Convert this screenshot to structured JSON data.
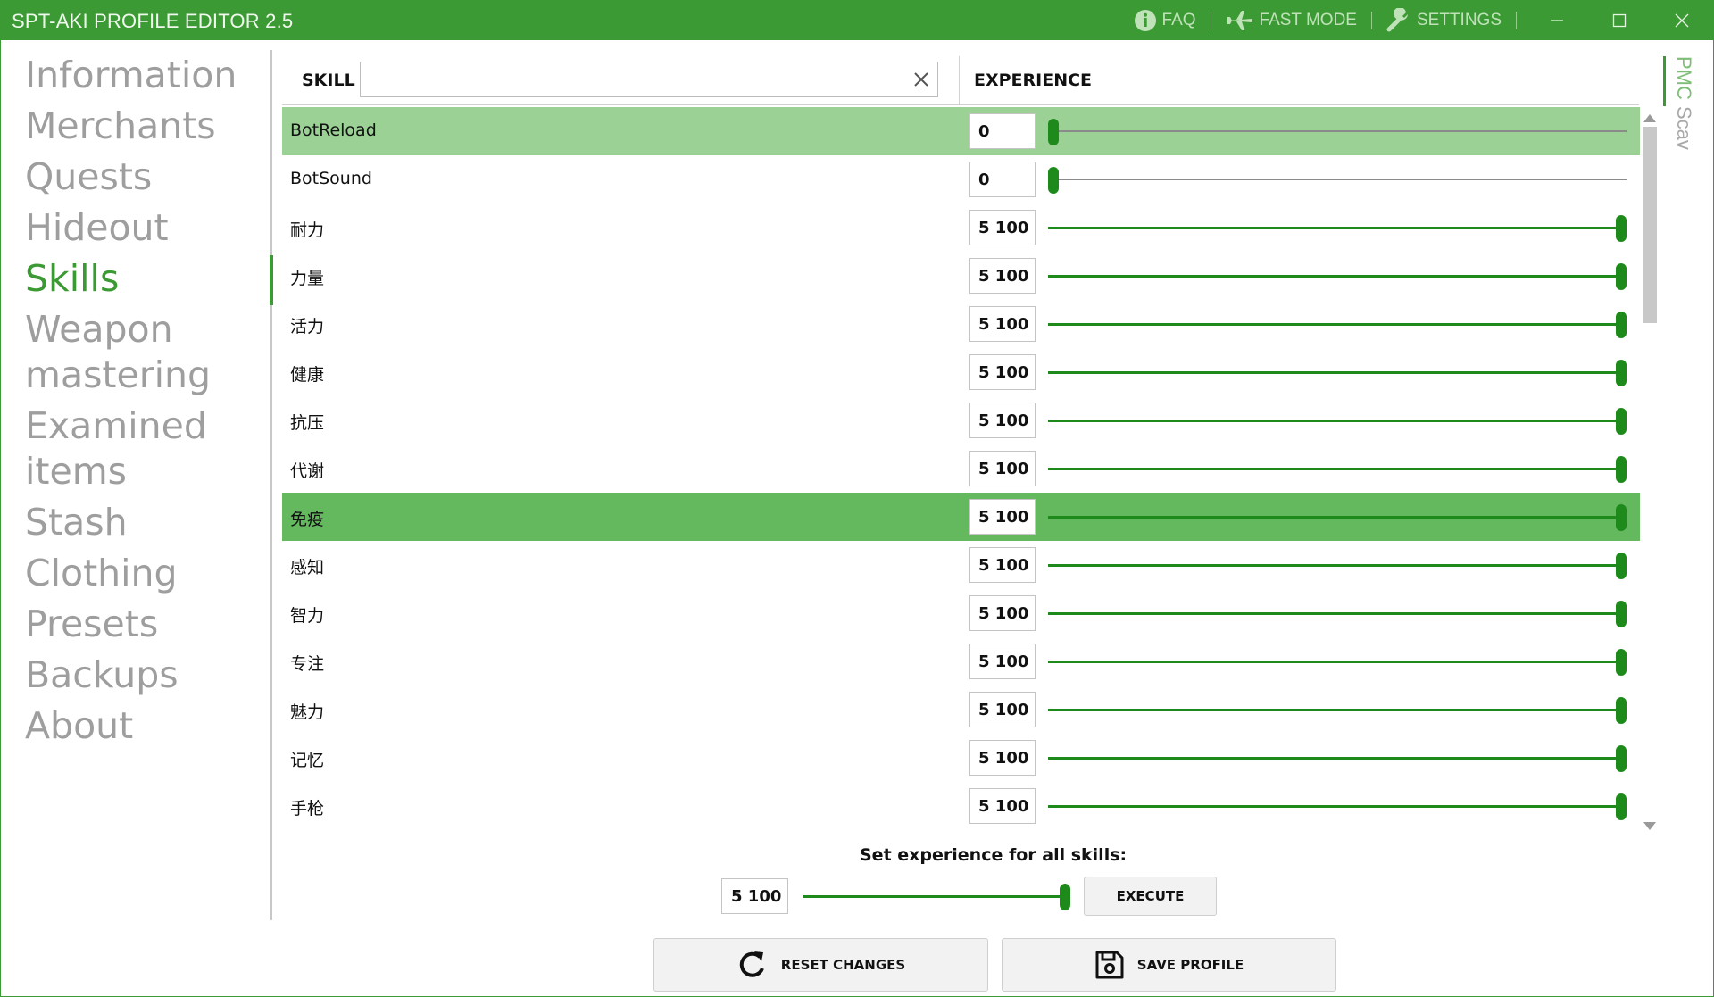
{
  "titlebar": {
    "title": "SPT-AKI PROFILE EDITOR  2.5",
    "faq_label": "FAQ",
    "fast_mode_label": "FAST MODE",
    "settings_label": "SETTINGS",
    "accent": "#3c9a34"
  },
  "sidebar": {
    "items": [
      {
        "label": "Information"
      },
      {
        "label": "Merchants"
      },
      {
        "label": "Quests"
      },
      {
        "label": "Hideout"
      },
      {
        "label": "Skills",
        "active": true
      },
      {
        "label": "Weapon",
        "label2": "mastering"
      },
      {
        "label": "Examined",
        "label2": "items"
      },
      {
        "label": "Stash"
      },
      {
        "label": "Clothing"
      },
      {
        "label": "Presets"
      },
      {
        "label": "Backups"
      },
      {
        "label": "About"
      }
    ]
  },
  "table": {
    "skill_header": "SKILL",
    "experience_header": "EXPERIENCE",
    "search_value": "",
    "slider_max": 5100,
    "rows": [
      {
        "name": "BotReload",
        "value": "0",
        "exp": 0,
        "state": "selected"
      },
      {
        "name": "BotSound",
        "value": "0",
        "exp": 0,
        "state": ""
      },
      {
        "name": "耐力",
        "value": "5 100",
        "exp": 5100,
        "state": ""
      },
      {
        "name": "力量",
        "value": "5 100",
        "exp": 5100,
        "state": ""
      },
      {
        "name": "活力",
        "value": "5 100",
        "exp": 5100,
        "state": ""
      },
      {
        "name": "健康",
        "value": "5 100",
        "exp": 5100,
        "state": ""
      },
      {
        "name": "抗压",
        "value": "5 100",
        "exp": 5100,
        "state": ""
      },
      {
        "name": "代谢",
        "value": "5 100",
        "exp": 5100,
        "state": ""
      },
      {
        "name": "免疫",
        "value": "5 100",
        "exp": 5100,
        "state": "hover"
      },
      {
        "name": "感知",
        "value": "5 100",
        "exp": 5100,
        "state": ""
      },
      {
        "name": "智力",
        "value": "5 100",
        "exp": 5100,
        "state": ""
      },
      {
        "name": "专注",
        "value": "5 100",
        "exp": 5100,
        "state": ""
      },
      {
        "name": "魅力",
        "value": "5 100",
        "exp": 5100,
        "state": ""
      },
      {
        "name": "记忆",
        "value": "5 100",
        "exp": 5100,
        "state": ""
      },
      {
        "name": "手枪",
        "value": "5 100",
        "exp": 5100,
        "state": ""
      }
    ]
  },
  "right_tabs": {
    "pmc": "PMC",
    "scav": "Scav"
  },
  "set_all": {
    "label": "Set experience for all skills:",
    "value": "5 100",
    "exp": 5100,
    "execute_label": "EXECUTE"
  },
  "actions": {
    "reset_label": "RESET CHANGES",
    "save_label": "SAVE PROFILE"
  }
}
